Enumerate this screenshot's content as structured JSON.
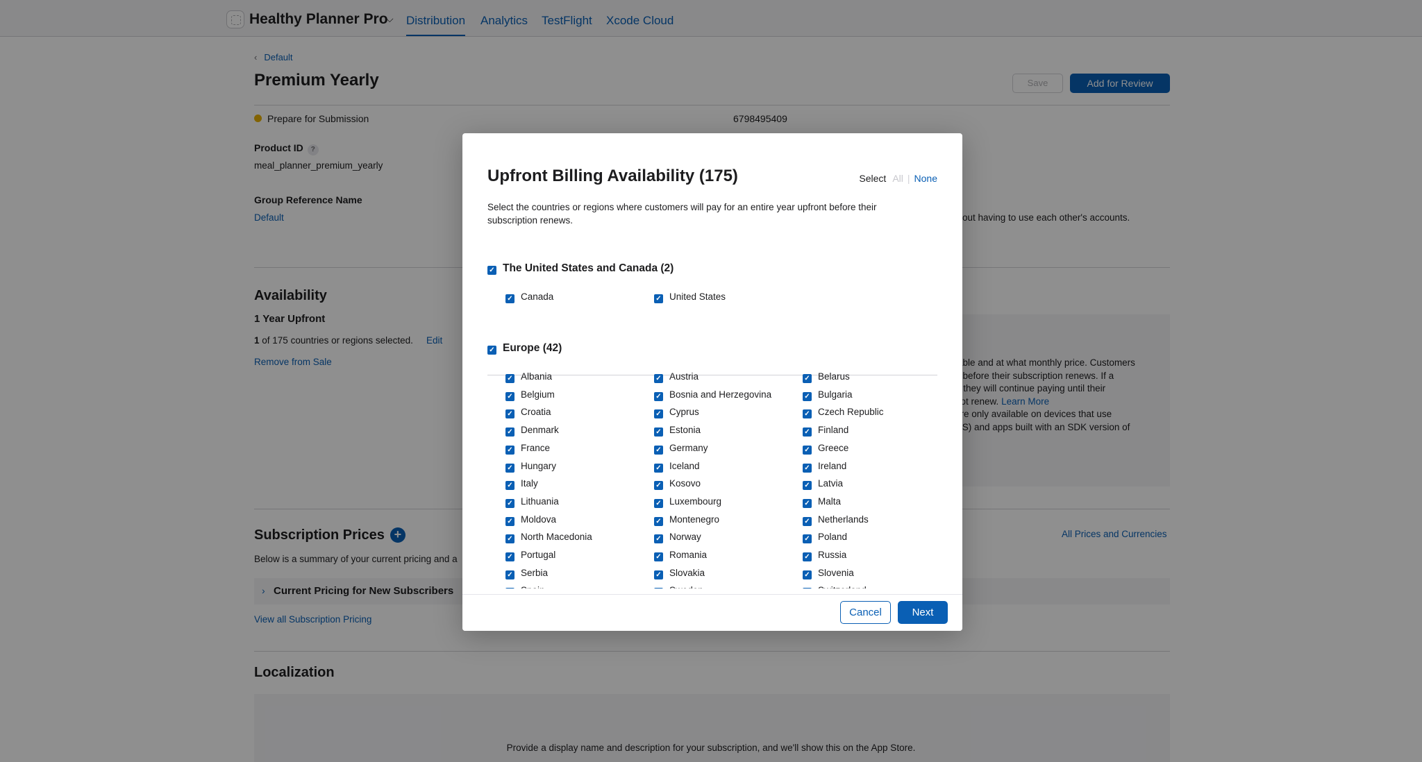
{
  "nav": {
    "app_name": "Healthy Planner Pro",
    "tabs": [
      "Distribution",
      "Analytics",
      "TestFlight",
      "Xcode Cloud"
    ],
    "active_tab": "Distribution"
  },
  "page": {
    "back_label": "Default",
    "title": "Premium Yearly",
    "save_label": "Save",
    "add_review_label": "Add for Review",
    "status_text": "Prepare for Submission",
    "apple_id": "6798495409",
    "product_id_label": "Product ID",
    "product_id_help": "?",
    "product_id_value": "meal_planner_premium_yearly",
    "group_ref_label": "Group Reference Name",
    "group_ref_value": "Default",
    "family_text_fragment": "out having to use each other's accounts.",
    "availability": {
      "title": "Availability",
      "subtitle": "1 Year Upfront",
      "count_bold": "1",
      "count_rest": "of 175 countries or regions selected.",
      "edit_label": "Edit",
      "remove_label": "Remove from Sale",
      "info_lines": [
        "lable and at what monthly price. Customers",
        "s before their subscription renews. If a",
        "t, they will continue paying until their",
        "not renew."
      ],
      "learn_more": "Learn More",
      "info_lines_2": [
        "are only available on devices that use",
        "DS) and apps built with an SDK version of"
      ]
    },
    "prices": {
      "title": "Subscription Prices",
      "summary": "Below is a summary of your current pricing and a",
      "all_prices_link": "All Prices and Currencies",
      "current_pricing": "Current Pricing for New Subscribers",
      "view_all_link": "View all Subscription Pricing"
    },
    "localization": {
      "title": "Localization",
      "hint": "Provide a display name and description for your subscription, and we'll show this on the App Store."
    }
  },
  "modal": {
    "title": "Upfront Billing Availability (175)",
    "select_label": "Select",
    "select_all": "All",
    "select_sep": "|",
    "select_none": "None",
    "description": "Select the countries or regions where customers will pay for an entire year upfront before their subscription renews.",
    "groups": [
      {
        "name": "The United States and Canada (2)",
        "checked": true,
        "countries": [
          "Canada",
          "United States"
        ]
      },
      {
        "name": "Europe (42)",
        "checked": true,
        "countries": [
          "Albania",
          "Austria",
          "Belarus",
          "Belgium",
          "Bosnia and Herzegovina",
          "Bulgaria",
          "Croatia",
          "Cyprus",
          "Czech Republic",
          "Denmark",
          "Estonia",
          "Finland",
          "France",
          "Germany",
          "Greece",
          "Hungary",
          "Iceland",
          "Ireland",
          "Italy",
          "Kosovo",
          "Latvia",
          "Lithuania",
          "Luxembourg",
          "Malta",
          "Moldova",
          "Montenegro",
          "Netherlands",
          "North Macedonia",
          "Norway",
          "Poland",
          "Portugal",
          "Romania",
          "Russia",
          "Serbia",
          "Slovakia",
          "Slovenia",
          "Spain",
          "Sweden",
          "Switzerland"
        ]
      }
    ],
    "check_glyph": "✓",
    "cancel_label": "Cancel",
    "next_label": "Next"
  },
  "colors": {
    "accent": "#0a5fb4",
    "status_yellow": "#e8b007",
    "overlay": "rgba(0,0,0,0.44)"
  },
  "icons": [
    "app-icon",
    "chevron-down-icon",
    "chevron-left-icon",
    "status-dot-icon",
    "help-icon",
    "plus-icon",
    "chevron-right-icon",
    "checkbox-checked-icon"
  ]
}
